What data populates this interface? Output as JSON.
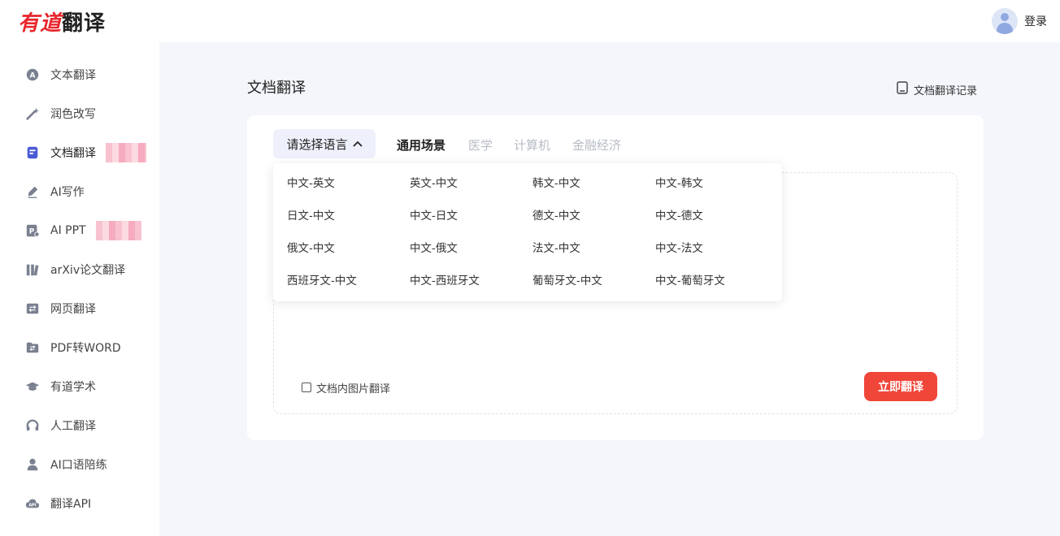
{
  "header": {
    "logo_brand": "有道",
    "logo_rest": "翻译",
    "login_label": "登录"
  },
  "sidebar": {
    "items": [
      {
        "label": "文本翻译",
        "icon": "text-translate-icon"
      },
      {
        "label": "润色改写",
        "icon": "magic-wand-icon"
      },
      {
        "label": "文档翻译",
        "icon": "document-icon"
      },
      {
        "label": "AI写作",
        "icon": "pen-icon"
      },
      {
        "label": "AI PPT",
        "icon": "ppt-icon"
      },
      {
        "label": "arXiv论文翻译",
        "icon": "books-icon"
      },
      {
        "label": "网页翻译",
        "icon": "webpage-icon"
      },
      {
        "label": "PDF转WORD",
        "icon": "folder-convert-icon"
      },
      {
        "label": "有道学术",
        "icon": "graduation-cap-icon"
      },
      {
        "label": "人工翻译",
        "icon": "headset-icon"
      },
      {
        "label": "AI口语陪练",
        "icon": "person-icon"
      },
      {
        "label": "翻译API",
        "icon": "api-cloud-icon"
      }
    ],
    "active_index": 2
  },
  "main": {
    "title": "文档翻译",
    "history_label": "文档翻译记录",
    "language_select_label": "请选择语言",
    "scene_tabs": [
      "通用场景",
      "医学",
      "计算机",
      "金融经济"
    ],
    "active_scene_index": 0,
    "image_translate_label": "文档内图片翻译",
    "image_translate_checked": false,
    "translate_button_label": "立即翻译"
  },
  "language_dropdown": {
    "pairs": [
      [
        "中文-英文",
        "英文-中文",
        "韩文-中文",
        "中文-韩文"
      ],
      [
        "日文-中文",
        "中文-日文",
        "德文-中文",
        "中文-德文"
      ],
      [
        "俄文-中文",
        "中文-俄文",
        "法文-中文",
        "中文-法文"
      ],
      [
        "西班牙文-中文",
        "中文-西班牙文",
        "葡萄牙文-中文",
        "中文-葡萄牙文"
      ]
    ]
  },
  "colors": {
    "accent_red": "#f0463a",
    "brand_red": "#e8262c",
    "icon_gray": "#7a8090",
    "active_icon": "#4a5bd6"
  }
}
